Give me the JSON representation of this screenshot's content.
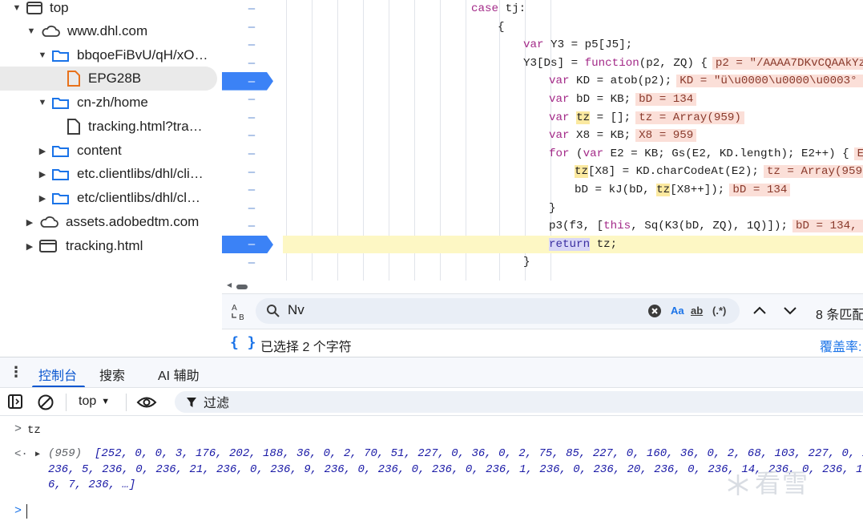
{
  "tree": {
    "items": [
      {
        "label": "top",
        "icon": "frame-icon",
        "expanded": true
      },
      {
        "label": "www.dhl.com",
        "icon": "cloud-icon",
        "expanded": true
      },
      {
        "label": "bbqoeFiBvU/qH/xO…",
        "icon": "folder-icon",
        "expanded": true
      },
      {
        "label": "EPG28B",
        "icon": "file-icon"
      },
      {
        "label": "cn-zh/home",
        "icon": "folder-icon",
        "expanded": true
      },
      {
        "label": "tracking.html?tra…",
        "icon": "file-icon"
      },
      {
        "label": "content",
        "icon": "folder-icon",
        "expanded": false
      },
      {
        "label": "etc.clientlibs/dhl/cli…",
        "icon": "folder-icon",
        "expanded": false
      },
      {
        "label": "etc/clientlibs/dhl/cl…",
        "icon": "folder-icon",
        "expanded": false
      },
      {
        "label": "assets.adobedtm.com",
        "icon": "cloud-icon",
        "expanded": false
      },
      {
        "label": "tracking.html",
        "icon": "frame-icon",
        "expanded": false
      }
    ]
  },
  "editor": {
    "gutter_marks": [
      "–",
      "–",
      "–",
      "–",
      "–",
      "–",
      "–",
      "–",
      "–",
      "–",
      "–",
      "–",
      "–",
      "–",
      "–"
    ],
    "lines": {
      "l0": {
        "a": "case ",
        "b": "tj",
        "c": ":"
      },
      "l1": {
        "a": "{"
      },
      "l2": {
        "kw": "var",
        "rest": " Y3 = p5[J5];"
      },
      "l3": {
        "a": "Y3[Ds] = ",
        "kw": "function",
        "b": "(p2, ZQ) {",
        "inline": "p2 = \"/AAAA7DKvCQAAkYz4"
      },
      "l4": {
        "kw": "var",
        "rest": " KD = atob(p2);",
        "inline": "KD = \"ü\\u0000\\u0000\\u0003° Ê"
      },
      "l5": {
        "kw": "var",
        "rest": " bD = KB;",
        "inline": "bD = 134"
      },
      "l6": {
        "kw": "var",
        "hl": "tz",
        "rest": " = [];",
        "inline": "tz = Array(959)"
      },
      "l7": {
        "kw": "var",
        "rest": " X8 = KB;",
        "inline": "X8 = 959"
      },
      "l8": {
        "kw": "for",
        "rest": " (",
        "kw2": "var",
        "rest2": " E2 = KB; Gs(E2, KD.length); E2++) {",
        "inline": "E2"
      },
      "l9": {
        "hl": "tz",
        "rest": "[X8] = KD.charCodeAt(E2);",
        "inline": "tz = Array(959)"
      },
      "l10": {
        "a": "bD = kJ(bD, ",
        "hl": "tz",
        "b": "[X8++]);",
        "inline": "bD = 134"
      },
      "l11": {
        "a": "}"
      },
      "l12": {
        "a": "p3(f3, [",
        "kw": "this",
        "b": ", Sq(K3(bD, ZQ), 1Q)]);",
        "inline": "bD = 134, Z"
      },
      "l13": {
        "kw": "return",
        "rest": " tz;"
      },
      "l14": {
        "a": "}"
      },
      "l15": {
        "a": "."
      }
    }
  },
  "search": {
    "value": "Nv",
    "case_label": "Aa",
    "word_label": "ab",
    "regex_label": "(.*)",
    "match_count": "8 条匹配"
  },
  "status": {
    "selection": "已选择 2 个字符",
    "coverage": "覆盖率:"
  },
  "drawer": {
    "tabs": [
      "控制台",
      "搜索",
      "AI 辅助"
    ]
  },
  "console_toolbar": {
    "context": "top",
    "filter_label": "过滤"
  },
  "console": {
    "input": "tz",
    "result_count": "(959)",
    "line1": "[252, 0, 0, 3, 176, 202, 188, 36, 0, 2, 70, 51, 227, 0, 36, 0, 2, 75, 85, 227, 0, 160, 36, 0, 2, 68, 103, 227, 0, 160, 3",
    "line2": "236, 5, 236, 0, 236, 21, 236, 0, 236, 9, 236, 0, 236, 0, 236, 0, 236, 1, 236, 0, 236, 20, 236, 0, 236, 14, 236, 0, 236, 17, 23",
    "line3": "6, 7, 236, …]"
  },
  "watermark": "看雪"
}
